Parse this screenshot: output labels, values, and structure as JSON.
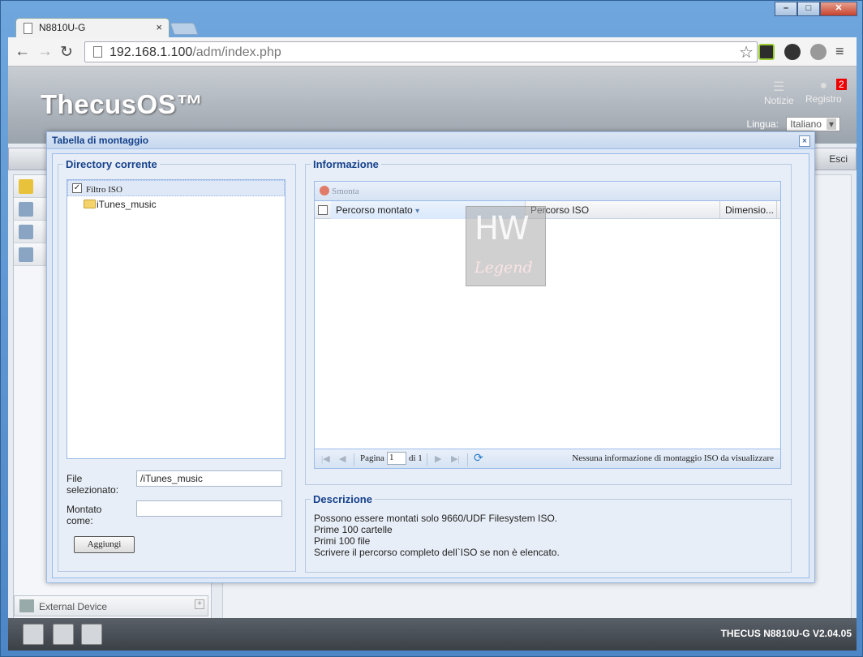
{
  "browser": {
    "tab_title": "N8810U-G",
    "tab_close": "×",
    "url_host": "192.168.1.100",
    "url_path": "/adm/index.php",
    "win_minimize": "–",
    "win_maximize": "□",
    "win_close": "✕"
  },
  "app": {
    "logo": "ThecusOS™",
    "header": {
      "notizie": "Notizie",
      "registro": "Registro",
      "registro_badge": "2",
      "lingua_label": "Lingua:",
      "lingua_value": "Italiano"
    },
    "esci": "Esci",
    "sidebar_bottom": {
      "external_device": "External Device"
    },
    "footer_text": "THECUS N8810U-G V2.04.05"
  },
  "modal": {
    "title": "Tabella di montaggio",
    "close": "×",
    "directory": {
      "legend": "Directory corrente",
      "tree": [
        {
          "label": "Filtro ISO",
          "checked": "✓"
        },
        {
          "label": "iTunes_music"
        }
      ],
      "file_label_1": "File",
      "file_label_2": "selezionato:",
      "file_value": "/iTunes_music",
      "mount_label_1": "Montato",
      "mount_label_2": "come:",
      "mount_value": "",
      "add_button": "Aggiungi"
    },
    "info": {
      "legend": "Informazione",
      "unmount": "Smonta",
      "columns": [
        "Percorso montato",
        "Percorso ISO",
        "Dimensio..."
      ],
      "sort_arrow": "▾",
      "pager": {
        "page_label": "Pagina",
        "page_value": "1",
        "of_label": "di 1",
        "empty_message": "Nessuna informazione di montaggio ISO da visualizzare",
        "first": "|◀",
        "prev": "◀",
        "next": "▶",
        "last": "▶|",
        "refresh": "⟳"
      }
    },
    "description": {
      "legend": "Descrizione",
      "lines": [
        "Possono essere montati solo 9660/UDF Filesystem ISO.",
        "Prime 100 cartelle",
        "Primi 100 file",
        "Scrivere il percorso completo dell`ISO se non è elencato."
      ]
    }
  },
  "watermark": {
    "hw": "HW",
    "legend": "Legend"
  },
  "colors": {
    "modal_title": "#15428b",
    "modal_border": "#99bbe8",
    "badge": "#e00000"
  }
}
